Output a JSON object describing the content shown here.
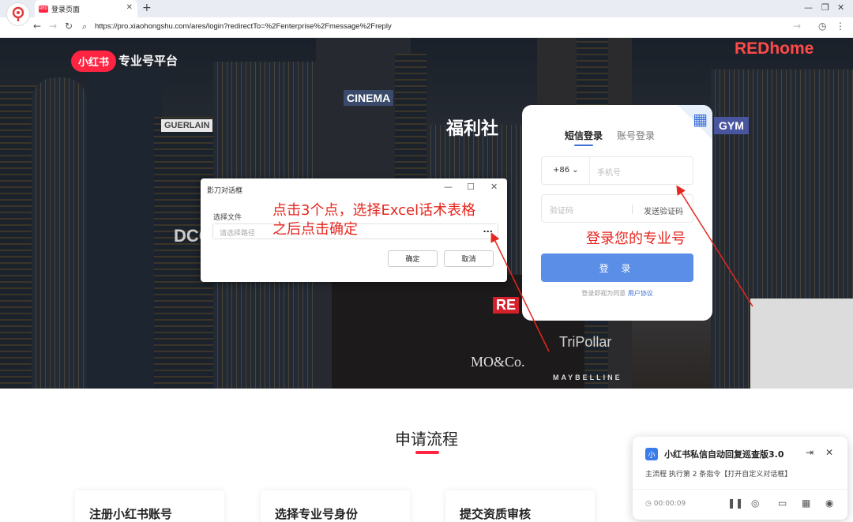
{
  "browser": {
    "tab_title": "登录页面",
    "new_tab": "+",
    "url": "https://pro.xiaohongshu.com/ares/login?redirectTo=%2Fenterprise%2Fmessage%2Freply",
    "favicon_text": "RED"
  },
  "page": {
    "brand_logo": "小红书",
    "brand_text": "专业号平台",
    "signs": [
      "CINEMA",
      "GUERLAIN",
      "福利社",
      "REDhome",
      "GYM",
      "TriPollar",
      "MO&Co.",
      "MAYBELLINE",
      "DCC",
      "RE"
    ]
  },
  "login": {
    "tabs": [
      "短信登录",
      "账号登录"
    ],
    "country_code": "+86",
    "phone_placeholder": "手机号",
    "code_placeholder": "验证码",
    "send_code": "发送验证码",
    "login_button": "登 录",
    "agree_prefix": "登录即视为同意",
    "agree_link": "用户协议"
  },
  "dialog": {
    "title": "影刀对话框",
    "label": "选择文件",
    "placeholder": "请选择路径",
    "more": "...",
    "ok": "确定",
    "cancel": "取消"
  },
  "annotations": {
    "dialog_hint_line1": "点击3个点，选择Excel话术表格",
    "dialog_hint_line2": "之后点击确定",
    "login_hint": "登录您的专业号"
  },
  "process": {
    "title": "申请流程",
    "steps": [
      "注册小红书账号",
      "选择专业号身份",
      "提交资质审核"
    ]
  },
  "rpa_panel": {
    "icon": "小",
    "title": "小红书私信自动回复巡查版3.0",
    "status": "主流程 执行第 2 条指令【打开自定义对话框】",
    "timer": "00:00:09"
  },
  "colors": {
    "brand_red": "#ff2442",
    "annotation_red": "#e6261f",
    "login_blue": "#5b8ee6"
  }
}
